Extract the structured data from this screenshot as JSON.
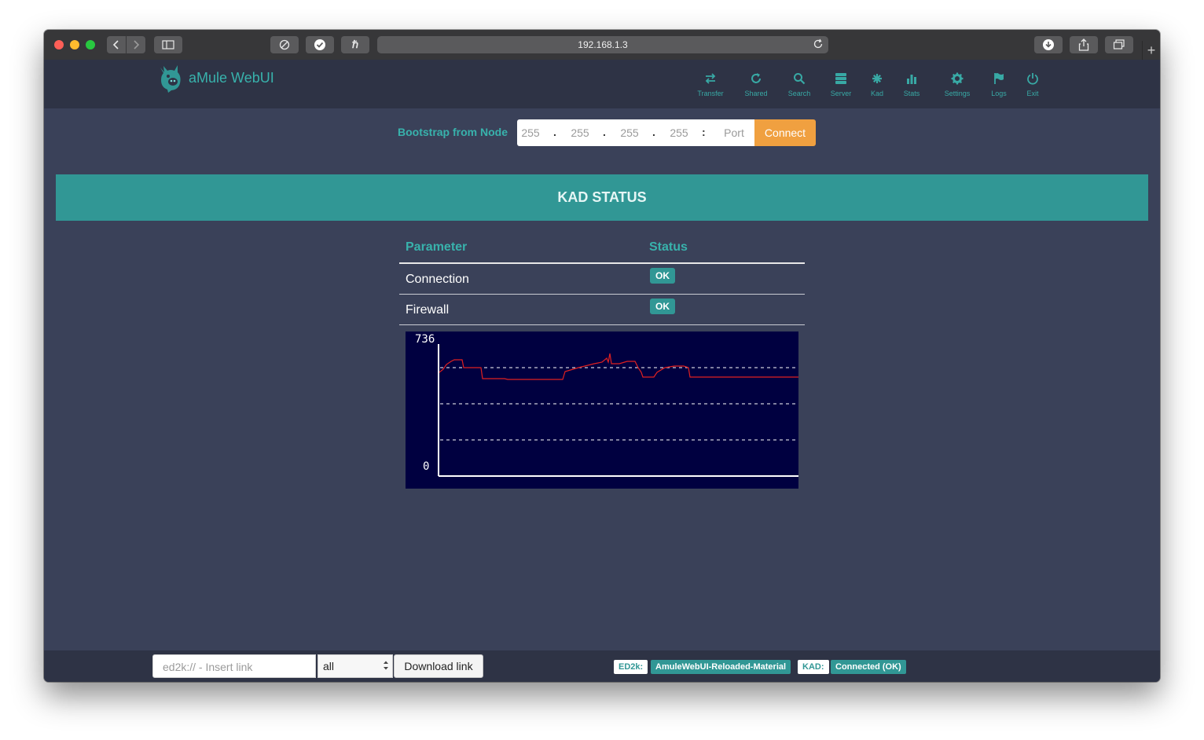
{
  "browser": {
    "url": "192.168.1.3",
    "new_tab": "+"
  },
  "app": {
    "title": "aMule WebUI"
  },
  "nav": {
    "items": [
      {
        "label": "Transfer",
        "icon": "transfer-icon"
      },
      {
        "label": "Shared",
        "icon": "shared-icon"
      },
      {
        "label": "Search",
        "icon": "search-icon"
      },
      {
        "label": "Server",
        "icon": "server-icon"
      },
      {
        "label": "Kad",
        "icon": "kad-icon"
      },
      {
        "label": "Stats",
        "icon": "stats-icon"
      },
      {
        "label": "Settings",
        "icon": "gear-icon"
      },
      {
        "label": "Logs",
        "icon": "flag-icon"
      },
      {
        "label": "Exit",
        "icon": "power-icon"
      }
    ]
  },
  "bootstrap": {
    "label": "Bootstrap from Node",
    "ip_placeholders": [
      "255",
      "255",
      "255",
      "255"
    ],
    "separators": [
      ".",
      ".",
      ".",
      ":"
    ],
    "port_placeholder": "Port",
    "connect_label": "Connect"
  },
  "kad_status": {
    "title": "KAD STATUS",
    "columns": [
      "Parameter",
      "Status"
    ],
    "rows": [
      {
        "parameter": "Connection",
        "status": "OK"
      },
      {
        "parameter": "Firewall",
        "status": "OK"
      }
    ]
  },
  "kad_graph": {
    "y_max_label": "736",
    "y_min_label": "0"
  },
  "footer": {
    "link_placeholder": "ed2k:// - Insert link",
    "category_value": "all",
    "download_label": "Download link",
    "ed2k_label": "ED2k:",
    "ed2k_value": "AmuleWebUI-Reloaded-Material",
    "kad_label": "KAD:",
    "kad_value": "Connected (OK)"
  },
  "colors": {
    "accent": "#38b2ac",
    "band": "#319795",
    "connect": "#f0a040",
    "background": "#3a4159",
    "graph_bg": "#000040",
    "graph_line": "#e02020"
  }
}
